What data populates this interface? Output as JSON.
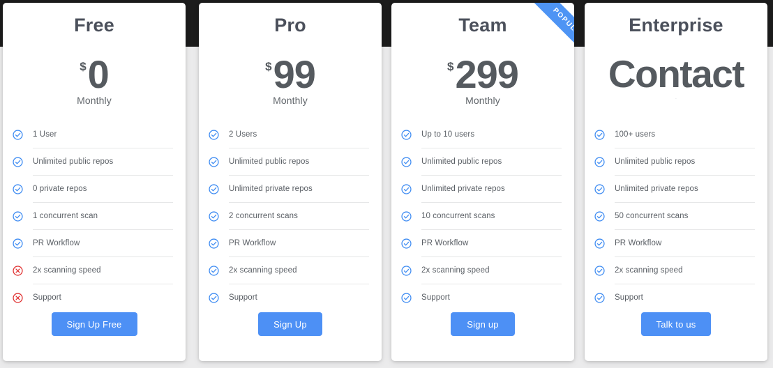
{
  "page": {
    "background_top_color": "#1c1c1c",
    "background_bottom_color": "#ebebec",
    "accent_color": "#4d90f5",
    "check_color": "#3d8bf2",
    "cross_color": "#e03030",
    "title_color": "#4b505b"
  },
  "ribbon": {
    "label": "POPULAR",
    "color": "#4e94f4",
    "on_plan_index": 2
  },
  "plans": [
    {
      "name": "Free",
      "currency": "$",
      "amount": "0",
      "period": "Monthly",
      "price_style": "number",
      "cta_label": "Sign Up Free",
      "popular": false,
      "features": [
        {
          "label": "1 User",
          "included": true
        },
        {
          "label": "Unlimited public repos",
          "included": true
        },
        {
          "label": "0 private repos",
          "included": true
        },
        {
          "label": "1 concurrent scan",
          "included": true
        },
        {
          "label": "PR Workflow",
          "included": true
        },
        {
          "label": "2x scanning speed",
          "included": false
        },
        {
          "label": "Support",
          "included": false
        }
      ]
    },
    {
      "name": "Pro",
      "currency": "$",
      "amount": "99",
      "period": "Monthly",
      "price_style": "number",
      "cta_label": "Sign Up",
      "popular": false,
      "features": [
        {
          "label": "2 Users",
          "included": true
        },
        {
          "label": "Unlimited public repos",
          "included": true
        },
        {
          "label": "Unlimited private repos",
          "included": true
        },
        {
          "label": "2 concurrent scans",
          "included": true
        },
        {
          "label": "PR Workflow",
          "included": true
        },
        {
          "label": "2x scanning speed",
          "included": true
        },
        {
          "label": "Support",
          "included": true
        }
      ]
    },
    {
      "name": "Team",
      "currency": "$",
      "amount": "299",
      "period": "Monthly",
      "price_style": "number",
      "cta_label": "Sign up",
      "popular": true,
      "features": [
        {
          "label": "Up to 10 users",
          "included": true
        },
        {
          "label": "Unlimited public repos",
          "included": true
        },
        {
          "label": "Unlimited private repos",
          "included": true
        },
        {
          "label": "10 concurrent scans",
          "included": true
        },
        {
          "label": "PR Workflow",
          "included": true
        },
        {
          "label": "2x scanning speed",
          "included": true
        },
        {
          "label": "Support",
          "included": true
        }
      ]
    },
    {
      "name": "Enterprise",
      "currency": "",
      "amount": "Contact",
      "period": "-",
      "price_style": "contact",
      "cta_label": "Talk to us",
      "popular": false,
      "features": [
        {
          "label": "100+ users",
          "included": true
        },
        {
          "label": "Unlimited public repos",
          "included": true
        },
        {
          "label": "Unlimited private repos",
          "included": true
        },
        {
          "label": "50 concurrent scans",
          "included": true
        },
        {
          "label": "PR Workflow",
          "included": true
        },
        {
          "label": "2x scanning speed",
          "included": true
        },
        {
          "label": "Support",
          "included": true
        }
      ]
    }
  ]
}
